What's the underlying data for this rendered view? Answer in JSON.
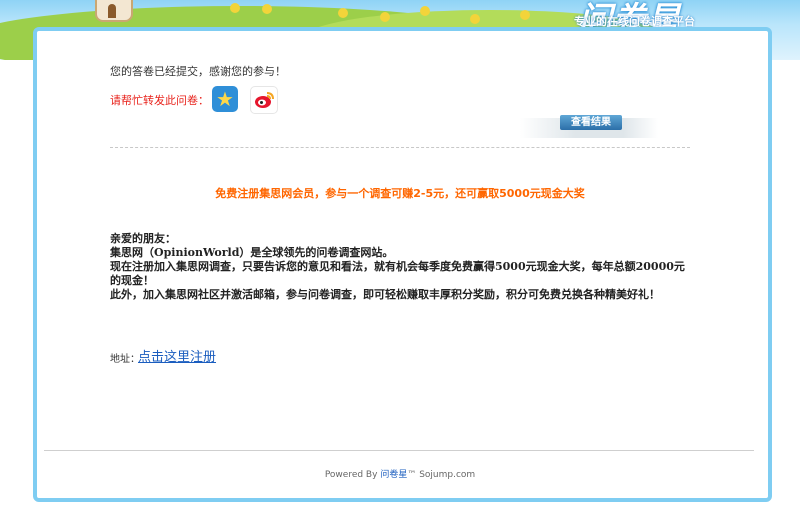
{
  "header": {
    "logo_text": "问卷星",
    "slogan": "专业的在线问卷调查平台"
  },
  "confirmation": {
    "message": "您的答卷已经提交，感谢您的参与！",
    "share_label": "请帮忙转发此问卷："
  },
  "share_icons": [
    "qzone-icon",
    "weibo-icon"
  ],
  "view_results_label": "查看结果",
  "promo": "免费注册集思网会员，参与一个调查可赚2-5元，还可赢取5000元现金大奖",
  "body": {
    "greeting": "亲爱的朋友：",
    "line1": "集思网（OpinionWorld）是全球领先的问卷调查网站。",
    "line2": "现在注册加入集思网调查，只要告诉您的意见和看法，就有机会每季度免费赢得5000元现金大奖，每年总额20000元的现金！",
    "line3": "此外，加入集思网社区并激活邮箱，参与问卷调查，即可轻松赚取丰厚积分奖励，积分可免费兑换各种精美好礼！"
  },
  "address_label": "地址：",
  "register_link": "点击这里注册",
  "footer": {
    "prefix": "Powered By ",
    "brand": "问卷星",
    "suffix": "™ Sojump.com"
  },
  "colors": {
    "frame_border": "#7fcdf2",
    "promo": "#ff6600",
    "share_label": "#e8221b",
    "link": "#1a5dbf"
  }
}
